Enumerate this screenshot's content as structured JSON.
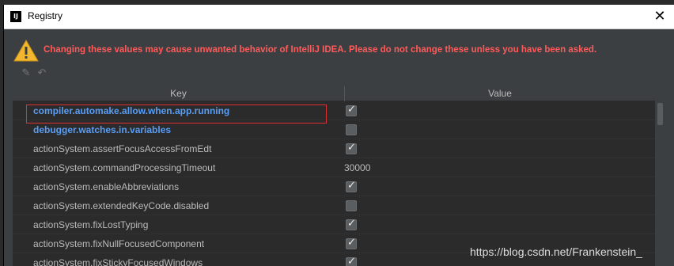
{
  "window": {
    "title": "Registry",
    "close_glyph": "✕"
  },
  "warning": {
    "icon": "warning-triangle-icon",
    "text": "Changing these values may cause unwanted behavior of IntelliJ IDEA. Please do not change these unless you have been asked."
  },
  "toolbar": {
    "edit_icon": "edit-icon",
    "revert_icon": "revert-icon"
  },
  "table": {
    "columns": {
      "key": "Key",
      "value": "Value"
    },
    "rows": [
      {
        "key": "compiler.automake.allow.when.app.running",
        "type": "checkbox",
        "checked": true,
        "modified": true
      },
      {
        "key": "debugger.watches.in.variables",
        "type": "checkbox",
        "checked": false,
        "modified": true
      },
      {
        "key": "actionSystem.assertFocusAccessFromEdt",
        "type": "checkbox",
        "checked": true,
        "modified": false
      },
      {
        "key": "actionSystem.commandProcessingTimeout",
        "type": "text",
        "value": "30000",
        "modified": false
      },
      {
        "key": "actionSystem.enableAbbreviations",
        "type": "checkbox",
        "checked": true,
        "modified": false
      },
      {
        "key": "actionSystem.extendedKeyCode.disabled",
        "type": "checkbox",
        "checked": false,
        "modified": false
      },
      {
        "key": "actionSystem.fixLostTyping",
        "type": "checkbox",
        "checked": true,
        "modified": false
      },
      {
        "key": "actionSystem.fixNullFocusedComponent",
        "type": "checkbox",
        "checked": true,
        "modified": false
      },
      {
        "key": "actionSystem.fixStickyFocusedWindows",
        "type": "checkbox",
        "checked": true,
        "modified": false
      }
    ]
  },
  "watermark": "https://blog.csdn.net/Frankenstein_",
  "colors": {
    "warning_text": "#ff5a5a",
    "modified_key": "#589df6",
    "highlight_border": "#e03030",
    "dialog_bg": "#3c3f41"
  }
}
